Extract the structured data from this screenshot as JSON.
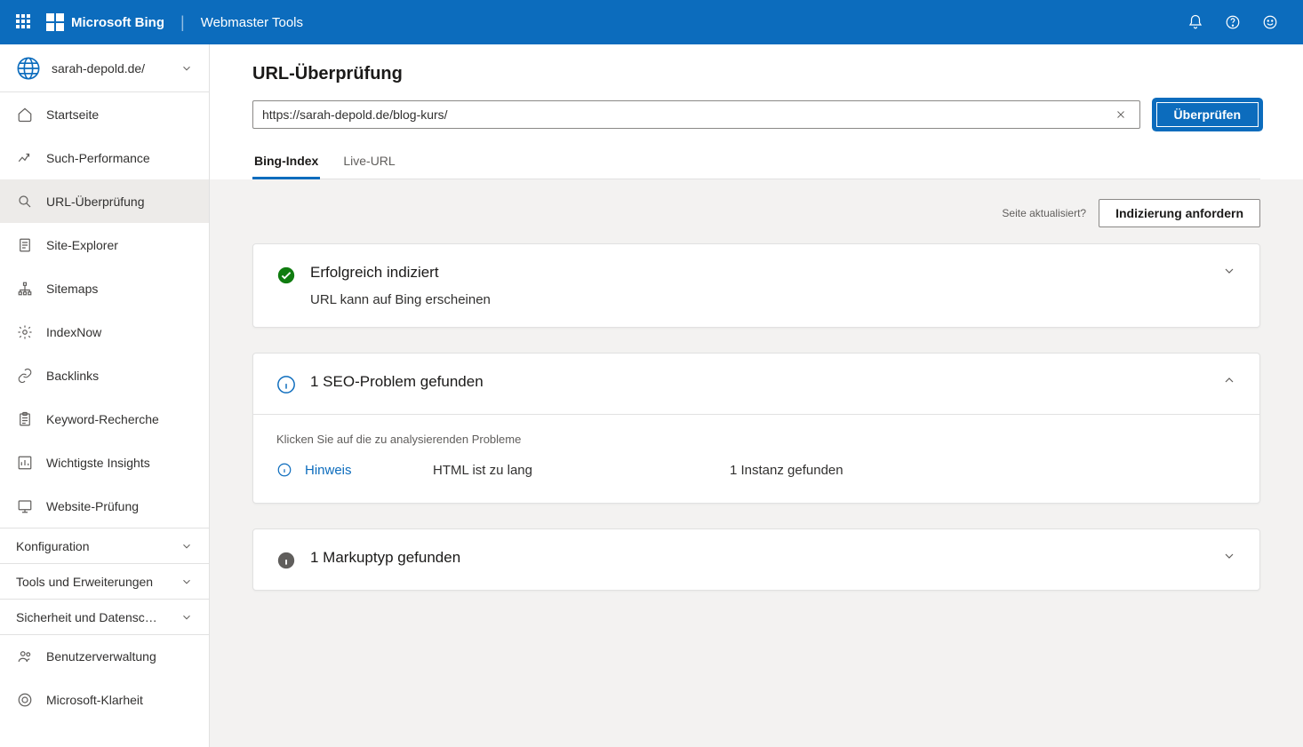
{
  "header": {
    "logo_text": "Microsoft Bing",
    "product_name": "Webmaster Tools"
  },
  "sidebar": {
    "site_domain": "sarah-depold.de/",
    "nav": {
      "home": "Startseite",
      "search_performance": "Such-Performance",
      "url_inspection": "URL-Überprüfung",
      "site_explorer": "Site-Explorer",
      "sitemaps": "Sitemaps",
      "indexnow": "IndexNow",
      "backlinks": "Backlinks",
      "keyword_research": "Keyword-Recherche",
      "top_insights": "Wichtigste Insights",
      "site_scan": "Website-Prüfung"
    },
    "sections": {
      "configuration": "Konfiguration",
      "tools": "Tools und Erweiterungen",
      "security": "Sicherheit und Datensc…",
      "user_mgmt": "Benutzerverwaltung",
      "ms_clarity": "Microsoft-Klarheit"
    }
  },
  "main": {
    "page_title": "URL-Überprüfung",
    "url_value": "https://sarah-depold.de/blog-kurs/",
    "inspect_label": "Überprüfen",
    "tabs": {
      "bing_index": "Bing-Index",
      "live_url": "Live-URL"
    },
    "action_hint": "Seite aktualisiert?",
    "request_indexing_label": "Indizierung anfordern",
    "cards": {
      "indexed": {
        "title": "Erfolgreich indiziert",
        "subtitle": "URL kann auf Bing erscheinen"
      },
      "seo": {
        "title": "1 SEO-Problem gefunden",
        "instruction": "Klicken Sie auf die zu analysierenden Probleme",
        "issue": {
          "severity": "Hinweis",
          "desc": "HTML ist zu lang",
          "count": "1 Instanz gefunden"
        }
      },
      "markup": {
        "title": "1 Markuptyp gefunden"
      }
    }
  }
}
